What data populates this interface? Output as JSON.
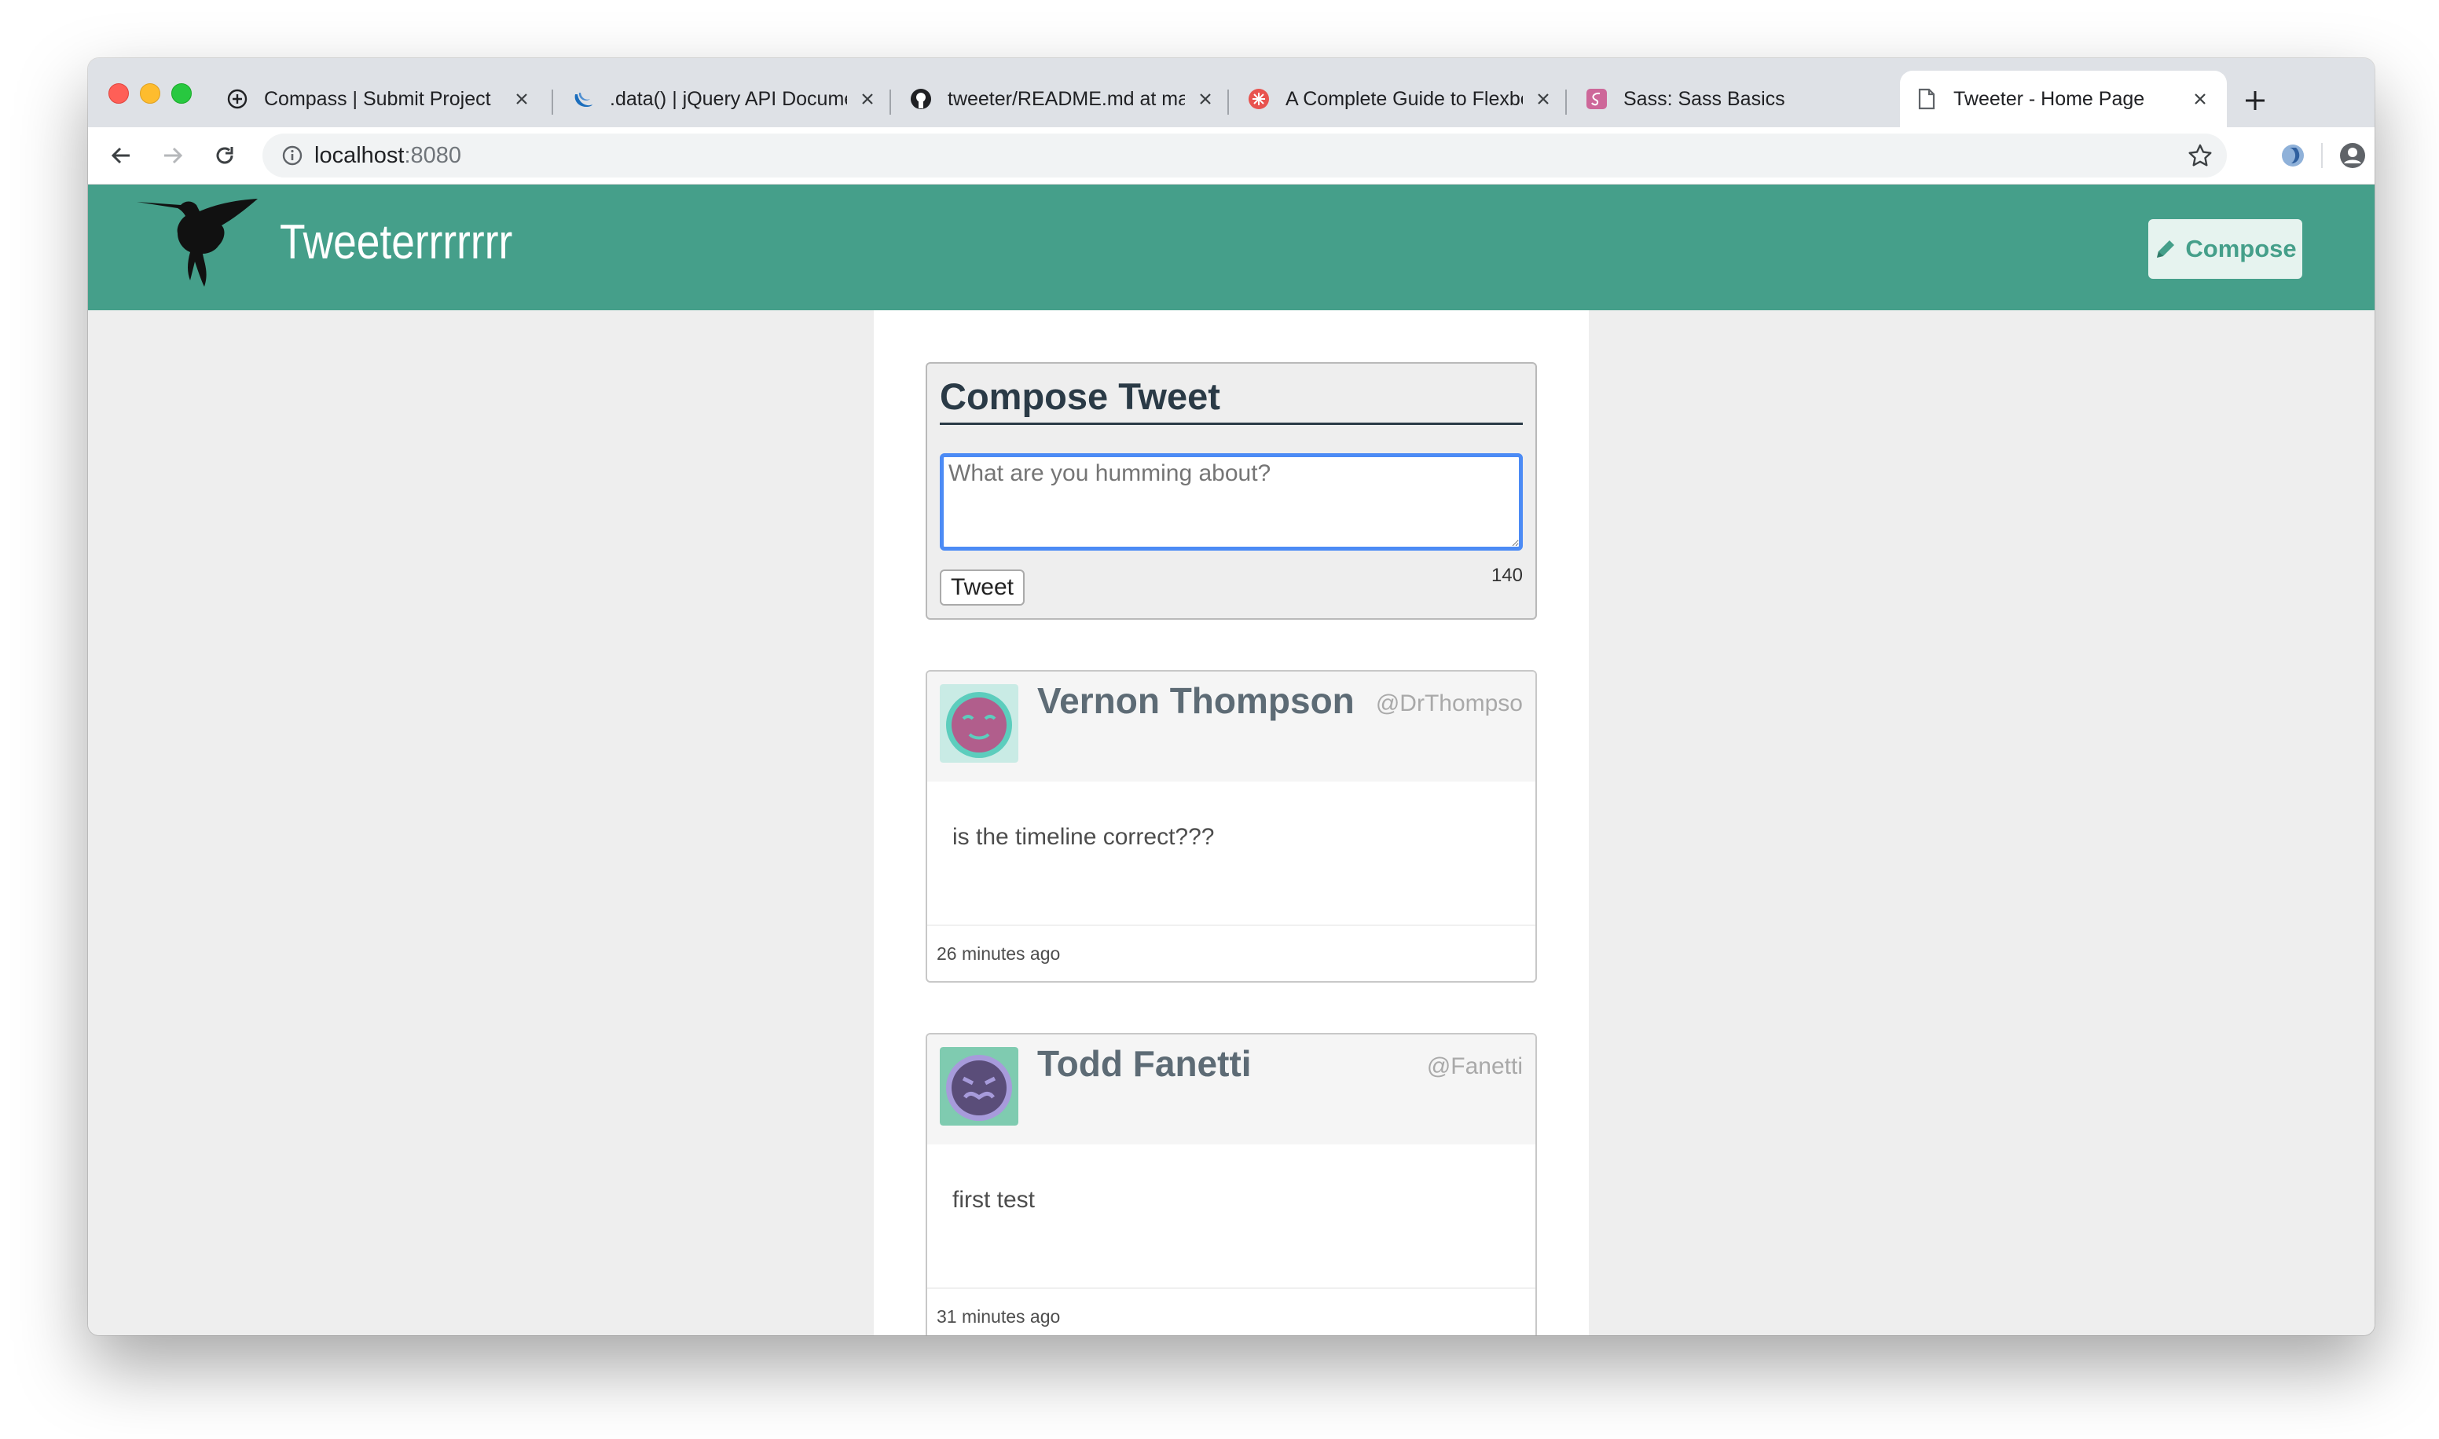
{
  "browser": {
    "tabs": [
      {
        "title": "Compass | Submit Project",
        "icon": "compass-add-icon"
      },
      {
        "title": ".data() | jQuery API Documentation",
        "icon": "jquery-icon"
      },
      {
        "title": "tweeter/README.md at master",
        "icon": "github-icon"
      },
      {
        "title": "A Complete Guide to Flexbox",
        "icon": "css-tricks-icon"
      },
      {
        "title": "Sass: Sass Basics",
        "icon": "sass-icon"
      },
      {
        "title": "Tweeter - Home Page",
        "icon": "page-icon",
        "active": true
      }
    ],
    "url_host": "localhost",
    "url_port": ":8080"
  },
  "nav": {
    "brand": "Tweeterrrrrrr",
    "compose_label": "Compose"
  },
  "composer": {
    "heading": "Compose Tweet",
    "placeholder": "What are you humming about?",
    "submit_label": "Tweet",
    "counter": "140"
  },
  "tweets": [
    {
      "name": "Vernon Thompson",
      "handle": "@DrThompso",
      "content": "is the timeline correct???",
      "time": "26 minutes ago",
      "avatar_bg": "#c9ebe5",
      "avatar_face": "#b15e8c",
      "avatar_ring": "#5ccdbd"
    },
    {
      "name": "Todd Fanetti",
      "handle": "@Fanetti",
      "content": "first test",
      "time": "31 minutes ago",
      "avatar_bg": "#7fcbb0",
      "avatar_face": "#5a4d79",
      "avatar_ring": "#a79bdb"
    }
  ],
  "colors": {
    "navbar": "#459f8a",
    "focus_ring": "#4c8bf5"
  }
}
